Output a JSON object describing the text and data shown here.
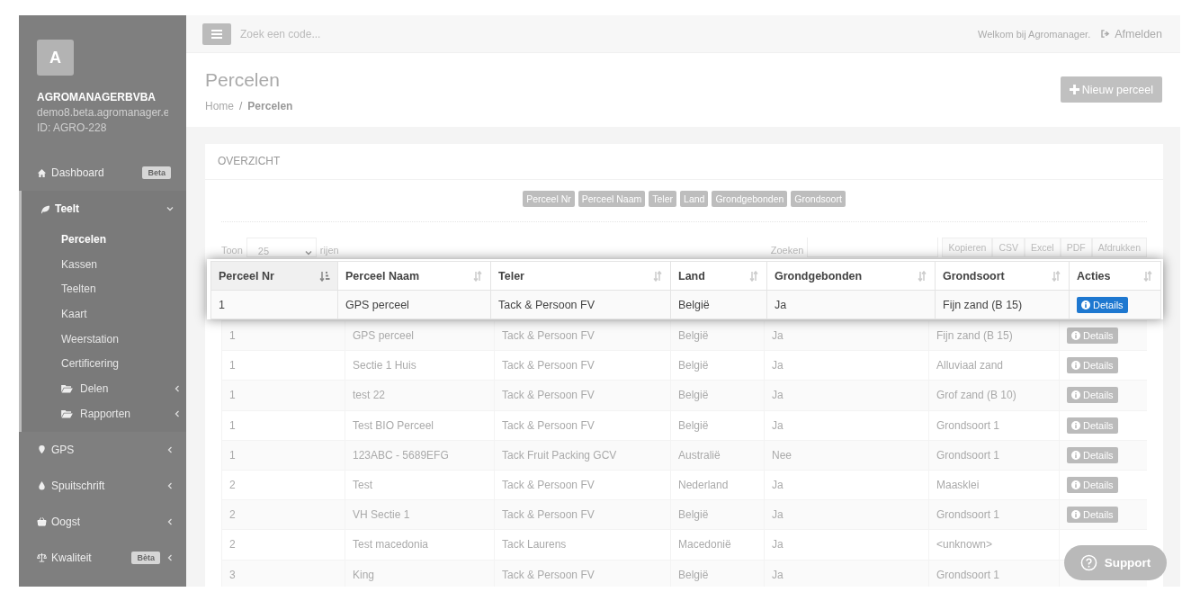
{
  "sidebar": {
    "avatar_letter": "A",
    "company": "AGROMANAGERBVBA",
    "domain": "demo8.beta.agromanager.e",
    "account_id": "ID: AGRO-228",
    "items": [
      {
        "label": "Dashboard",
        "badge": "Beta"
      },
      {
        "label": "Teelt",
        "expanded": true,
        "children": [
          {
            "label": "Percelen",
            "kind": "link",
            "selected": true
          },
          {
            "label": "Kassen",
            "kind": "link",
            "selected": false
          },
          {
            "label": "Teelten",
            "kind": "link",
            "selected": false
          },
          {
            "label": "Kaart",
            "kind": "link",
            "selected": false
          },
          {
            "label": "Weerstation",
            "kind": "link",
            "selected": false
          },
          {
            "label": "Certificering",
            "kind": "link",
            "selected": false
          },
          {
            "label": "Delen",
            "kind": "folder",
            "selected": false,
            "expanded": false
          },
          {
            "label": "Rapporten",
            "kind": "folder",
            "selected": false,
            "expanded": false
          }
        ]
      },
      {
        "label": "GPS",
        "expanded": false
      },
      {
        "label": "Spuitschrift",
        "expanded": false
      },
      {
        "label": "Oogst",
        "expanded": false
      },
      {
        "label": "Kwaliteit",
        "badge": "Bèta",
        "expanded": false
      }
    ]
  },
  "topbar": {
    "search": {
      "placeholder": "Zoek een code..."
    },
    "welcome": "Welkom bij Agromanager.",
    "logout": "Afmelden"
  },
  "header": {
    "title": "Percelen",
    "breadcrumb": [
      "Home",
      "Percelen"
    ],
    "breadcrumb_separator": "/",
    "new_button": "Nieuw perceel"
  },
  "card": {
    "title": "OVERZICHT",
    "column_toggles": [
      "Perceel Nr",
      "Perceel Naam",
      "Teler",
      "Land",
      "Grondgebonden",
      "Grondsoort"
    ],
    "length": {
      "before": "Toon",
      "value": "25",
      "after": "rijen"
    },
    "search_label": "Zoeken",
    "export_buttons": [
      "Kopieren",
      "CSV",
      "Excel",
      "PDF",
      "Afdrukken"
    ]
  },
  "spotlight": {
    "columns": [
      {
        "label": "Perceel Nr",
        "sorted": true
      },
      {
        "label": "Perceel Naam",
        "sorted": false
      },
      {
        "label": "Teler",
        "sorted": false
      },
      {
        "label": "Land",
        "sorted": false
      },
      {
        "label": "Grondgebonden",
        "sorted": false
      },
      {
        "label": "Grondsoort",
        "sorted": false
      },
      {
        "label": "Acties",
        "sorted": false
      }
    ],
    "rows": [
      {
        "cells": [
          "1",
          "GPS perceel",
          "Tack & Persoon FV",
          "België",
          "Ja",
          "Fijn zand (B 15)"
        ],
        "action": "Details"
      }
    ]
  },
  "table": {
    "rows": [
      {
        "cells": [
          "1",
          "GPS perceel",
          "Tack & Persoon FV",
          "België",
          "Ja",
          "Fijn zand (B 15)"
        ],
        "action": "Details"
      },
      {
        "cells": [
          "1",
          "Sectie 1 Huis",
          "Tack & Persoon FV",
          "België",
          "Ja",
          "Alluviaal zand"
        ],
        "action": "Details"
      },
      {
        "cells": [
          "1",
          "test 22",
          "Tack & Persoon FV",
          "België",
          "Ja",
          "Grof zand (B 10)"
        ],
        "action": "Details"
      },
      {
        "cells": [
          "1",
          "Test BIO Perceel",
          "Tack & Persoon FV",
          "België",
          "Ja",
          "Grondsoort 1"
        ],
        "action": "Details"
      },
      {
        "cells": [
          "1",
          "123ABC - 5689EFG",
          "Tack Fruit Packing GCV",
          "Australië",
          "Nee",
          "Grondsoort 1"
        ],
        "action": "Details"
      },
      {
        "cells": [
          "2",
          "Test",
          "Tack & Persoon FV",
          "Nederland",
          "Ja",
          "Maasklei"
        ],
        "action": "Details"
      },
      {
        "cells": [
          "2",
          "VH Sectie 1",
          "Tack & Persoon FV",
          "België",
          "Ja",
          "Grondsoort 1"
        ],
        "action": "Details"
      },
      {
        "cells": [
          "2",
          "Test macedonia",
          "Tack Laurens",
          "Macedonië",
          "Ja",
          "<unknown>"
        ]
      },
      {
        "cells": [
          "3",
          "King",
          "Tack & Persoon FV",
          "België",
          "Ja",
          "Grondsoort 1"
        ]
      }
    ]
  },
  "support": {
    "label": "Support"
  }
}
